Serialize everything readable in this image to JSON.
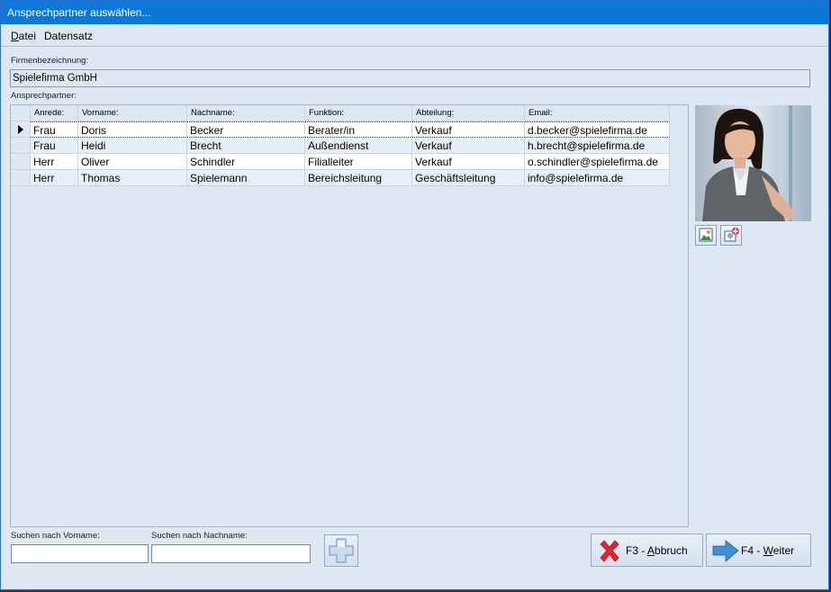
{
  "window": {
    "title": "Ansprechpartner auswählen..."
  },
  "menu": [
    {
      "label_underlined": "D",
      "label_rest": "atei"
    },
    {
      "label_underlined": "",
      "label_rest": "Datensatz"
    }
  ],
  "company": {
    "label": "Firmenbezeichnung:",
    "value": "Spielefirma GmbH"
  },
  "contacts": {
    "label": "Ansprechpartner:",
    "columns": [
      "Anrede:",
      "Vorname:",
      "Nachname:",
      "Funktion:",
      "Abteilung:",
      "Email:"
    ],
    "rows": [
      [
        "Frau",
        "Doris",
        "Becker",
        "Berater/in",
        "Verkauf",
        "d.becker@spielefirma.de"
      ],
      [
        "Frau",
        "Heidi",
        "Brecht",
        "Außendienst",
        "Verkauf",
        "h.brecht@spielefirma.de"
      ],
      [
        "Herr",
        "Oliver",
        "Schindler",
        "Filialleiter",
        "Verkauf",
        "o.schindler@spielefirma.de"
      ],
      [
        "Herr",
        "Thomas",
        "Spielemann",
        "Bereichsleitung",
        "Geschäftsleitung",
        "info@spielefirma.de"
      ]
    ]
  },
  "search": {
    "firstname_label": "Suchen nach Vorname:",
    "lastname_label": "Suchen nach Nachname:",
    "firstname_value": "",
    "lastname_value": ""
  },
  "buttons": {
    "cancel": {
      "prefix": "F3 - ",
      "underlined": "A",
      "rest": "bbruch"
    },
    "next": {
      "prefix": "F4 - ",
      "underlined": "W",
      "rest": "eiter"
    }
  },
  "icons": {
    "photo_image": "image-icon",
    "photo_change": "photo-edit-icon",
    "add": "plus-icon",
    "cancel": "red-x-icon",
    "next": "blue-arrow-right-icon"
  },
  "colors": {
    "titlebar": "#0a78d7",
    "window_bg": "#dde8f3",
    "cancel_x": "#e2242b",
    "next_arrow": "#3f8fd4"
  }
}
